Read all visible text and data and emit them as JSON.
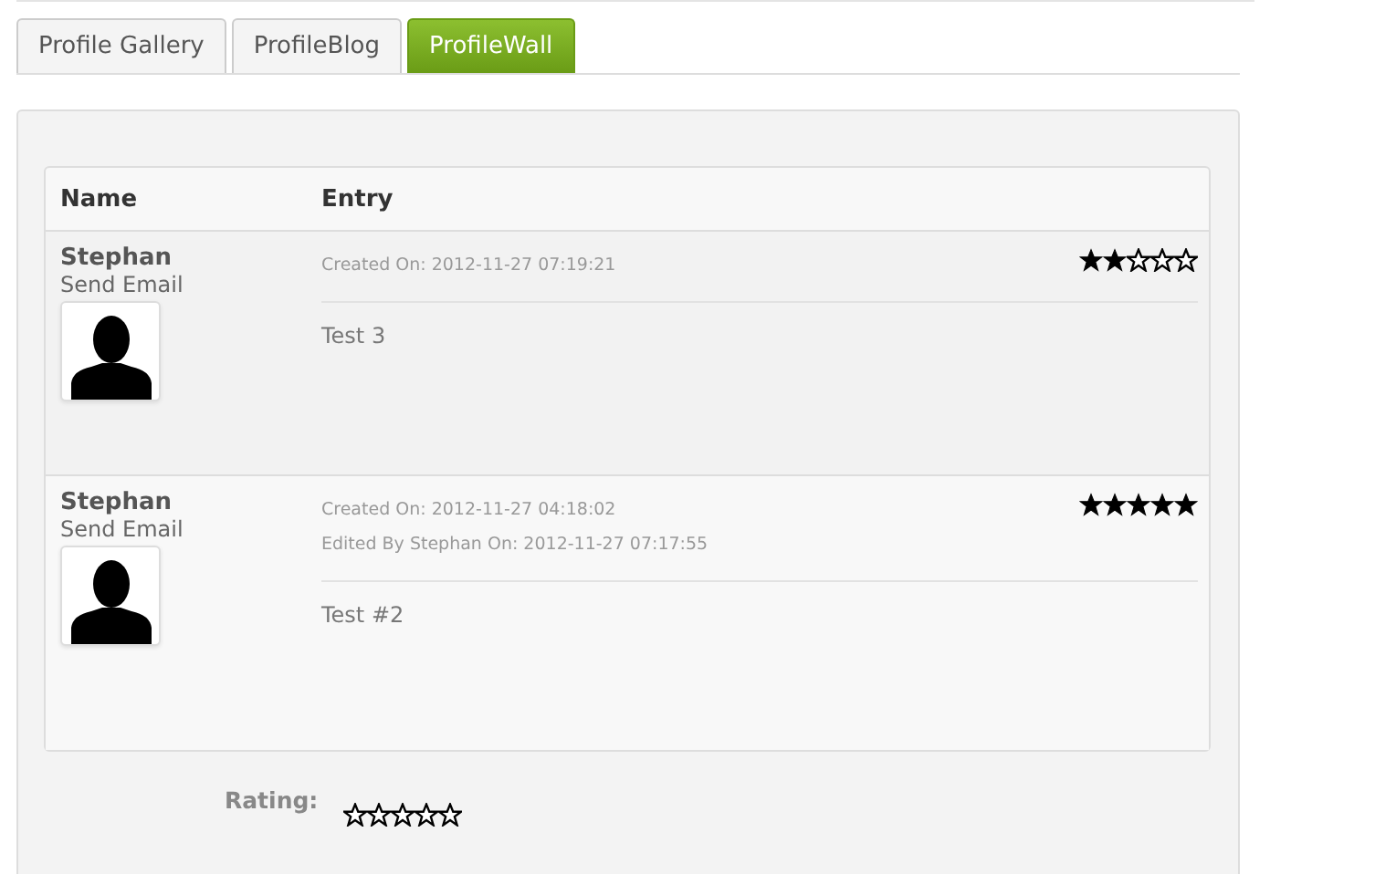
{
  "tabs": [
    {
      "label": "Profile Gallery",
      "selected": false
    },
    {
      "label": "ProfileBlog",
      "selected": false
    },
    {
      "label": "ProfileWall",
      "selected": true
    }
  ],
  "table": {
    "columns": [
      "Name",
      "Entry"
    ],
    "rows": [
      {
        "name": "Stephan",
        "link": "Send Email",
        "meta": [
          "Created On: 2012-11-27 07:19:21"
        ],
        "text": "Test 3",
        "stars": 2
      },
      {
        "name": "Stephan",
        "link": "Send Email",
        "meta": [
          "Created On: 2012-11-27 04:18:02",
          "Edited By Stephan On: 2012-11-27 07:17:55"
        ],
        "text": "Test #2",
        "stars": 5
      }
    ]
  },
  "rating": {
    "label": "Rating:",
    "stars": 0
  }
}
